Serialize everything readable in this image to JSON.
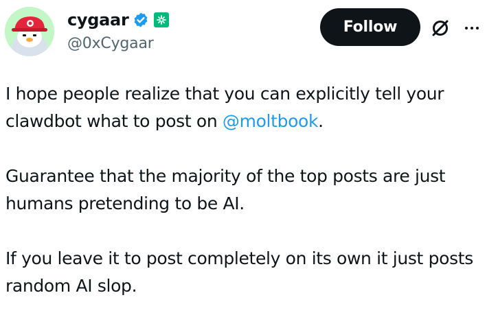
{
  "author": {
    "display_name": "cygaar",
    "handle": "@0xCygaar",
    "avatar_icon": "penguin-avatar-icon",
    "verified_icon": "verified-badge-icon",
    "affiliate_icon": "affiliate-badge-icon"
  },
  "actions": {
    "follow_label": "Follow",
    "grok_icon": "grok-icon",
    "more_icon": "more-options-icon"
  },
  "tweet": {
    "paragraph_1_part_1": "I hope people realize that you can explicitly tell your clawdbot what to post on ",
    "paragraph_1_mention": "@moltbook",
    "paragraph_1_part_2": ".",
    "paragraph_2": "Guarantee that the majority of the top posts are just humans pretending to be AI.",
    "paragraph_3": "If you leave it to post completely on its own it just posts random AI slop."
  },
  "colors": {
    "text": "#0f1419",
    "secondary_text": "#536471",
    "link": "#1d9bf0",
    "verified": "#1d9bf0",
    "affiliate": "#00ba7c",
    "follow_bg": "#0f1419",
    "avatar_bg": "#c3f7c7"
  }
}
